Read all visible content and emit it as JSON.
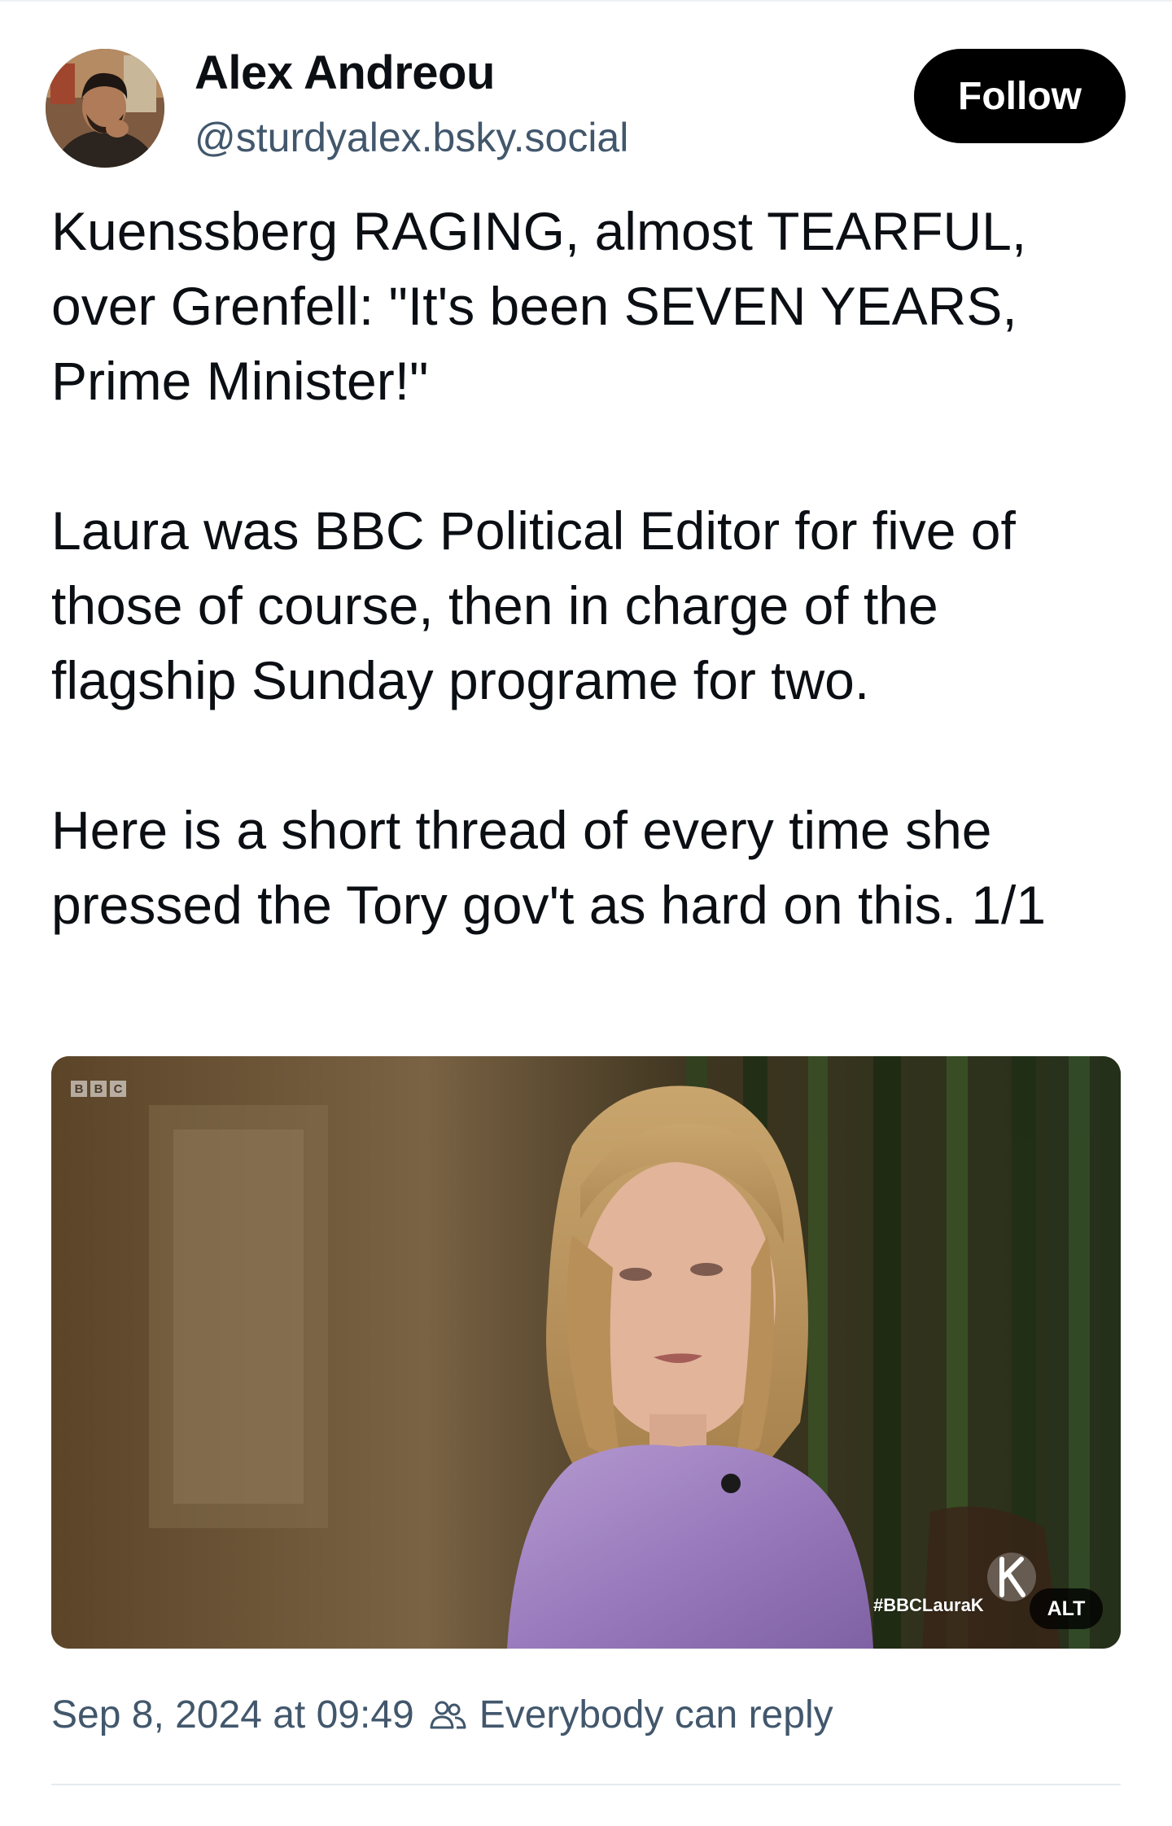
{
  "author": {
    "display_name": "Alex Andreou",
    "handle": "@sturdyalex.bsky.social"
  },
  "follow_button": {
    "label": "Follow"
  },
  "post": {
    "paragraphs": [
      "Kuenssberg RAGING, almost TEARFUL, over Grenfell: \"It's been SEVEN YEARS, Prime Minister!\"",
      "Laura was BBC Political Editor for five of those of course, then in charge of the flagship Sunday programe for two.",
      "Here is a short thread of every time she pressed the Tory gov't as hard on this. 1/1"
    ]
  },
  "media": {
    "channel_logo_letters": [
      "B",
      "B",
      "C"
    ],
    "hashtag_overlay": "#BBCLauraK",
    "alt_badge": "ALT"
  },
  "meta": {
    "timestamp": "Sep 8, 2024 at 09:49",
    "reply_setting": "Everybody can reply"
  },
  "icons": {
    "avatar": "avatar-photo",
    "reply_audience": "people-icon",
    "show_logo": "k-logo-icon"
  },
  "colors": {
    "follow_bg": "#000000",
    "secondary_text": "#42576c",
    "primary_text": "#0b0f14"
  }
}
